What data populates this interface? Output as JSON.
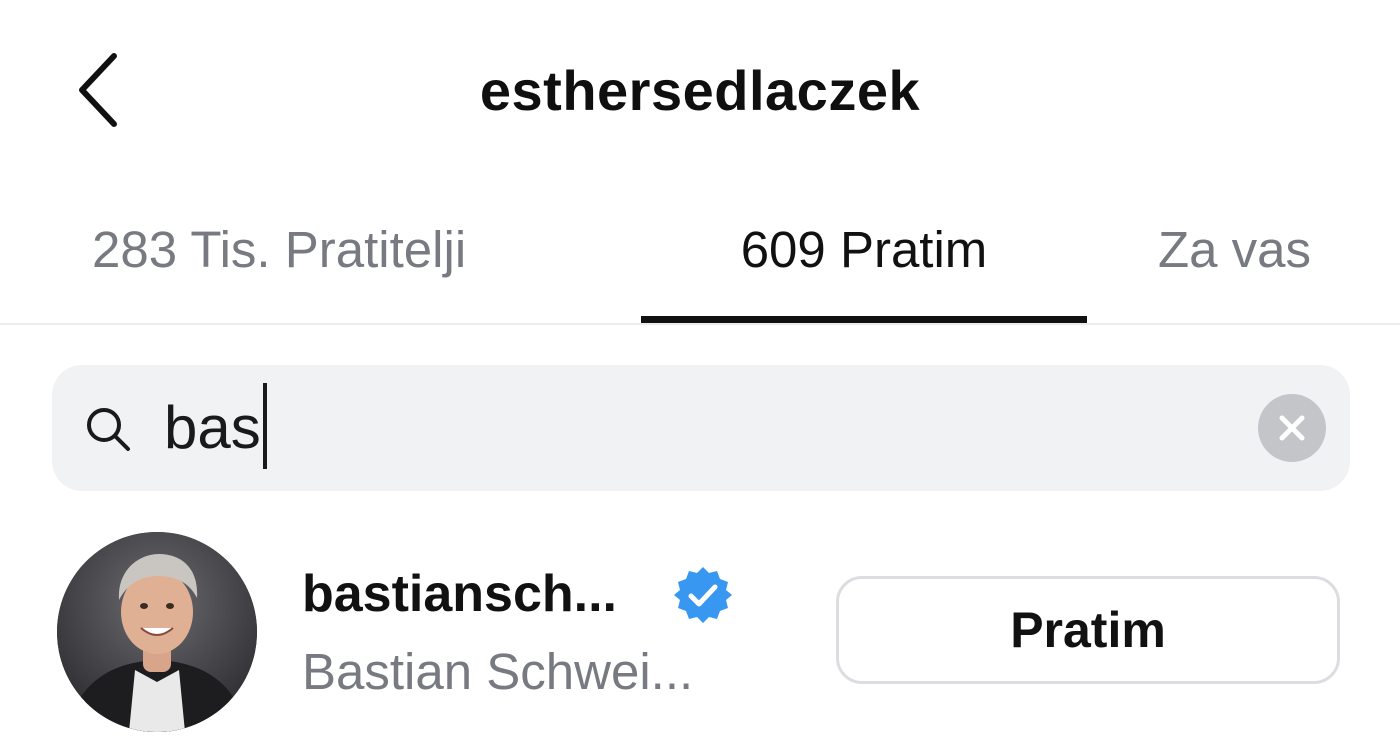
{
  "header": {
    "title": "esthersedlaczek",
    "back_icon": "chevron-left-icon"
  },
  "tabs": [
    {
      "label": "283 Tis. Pratitelji",
      "active": false
    },
    {
      "label": "609 Pratim",
      "active": true
    },
    {
      "label": "Za vas",
      "active": false
    }
  ],
  "search": {
    "value": "bas",
    "icon": "search-icon",
    "clear_icon": "clear-icon"
  },
  "results": [
    {
      "username": "bastiansch...",
      "verified": true,
      "full_name": "Bastian Schwei...",
      "button_label": "Pratim"
    }
  ],
  "colors": {
    "primary_text": "#111111",
    "secondary_text": "#777a80",
    "search_bg": "#f1f2f4",
    "verified_blue": "#3897f0",
    "button_border": "#dcdde0"
  }
}
